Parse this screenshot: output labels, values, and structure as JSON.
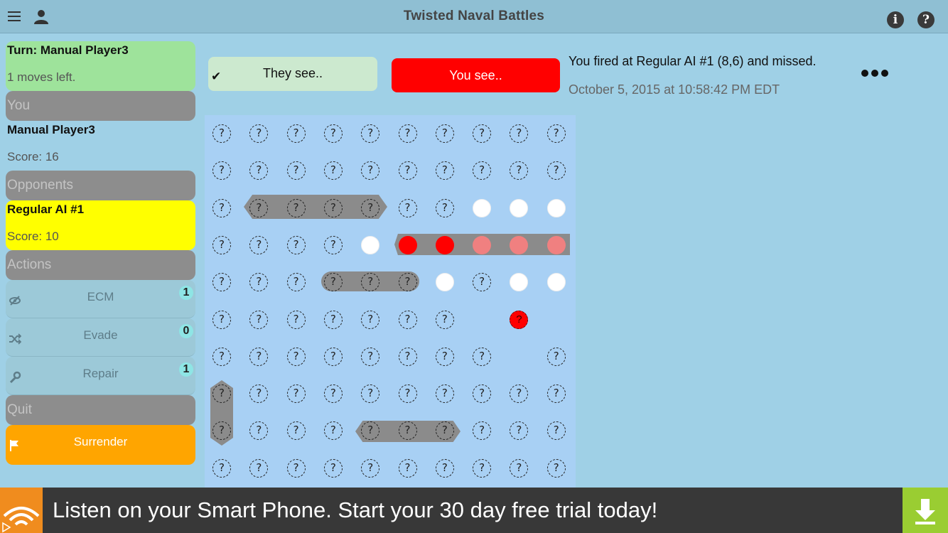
{
  "app": {
    "title": "Twisted Naval Battles"
  },
  "icons": {
    "menu": "menu-icon",
    "profile": "person-icon",
    "info": "info-icon",
    "help": "help-icon",
    "info_glyph": "i",
    "help_glyph": "?"
  },
  "sidebar": {
    "turn_label": "Turn: Manual Player3",
    "moves_left": "1 moves left.",
    "you_header": "You",
    "player_name": "Manual Player3",
    "player_score": "Score: 16",
    "opponents_header": "Opponents",
    "opponent_name": "Regular AI #1",
    "opponent_score": "Score: 10",
    "actions_header": "Actions",
    "actions": [
      {
        "label": "ECM",
        "count": "1",
        "icon": "eye-slash-icon"
      },
      {
        "label": "Evade",
        "count": "0",
        "icon": "shuffle-icon"
      },
      {
        "label": "Repair",
        "count": "1",
        "icon": "wrench-icon"
      }
    ],
    "quit_header": "Quit",
    "surrender_label": "Surrender"
  },
  "view_tabs": {
    "they_see": "They see..",
    "you_see": "You see..",
    "checkmark": "✔"
  },
  "status": {
    "message": "You fired at Regular AI #1 (8,6) and missed.",
    "timestamp": "October 5, 2015 at 10:58:42 PM EDT"
  },
  "board": {
    "unknown_glyph": "?",
    "hit_glyph": "?",
    "rows": [
      "UUUUUUUUUU",
      "UUUUUUUUUU",
      "UUUUUUUMMM",
      "UUUUMHHSSS",
      "UUUUUUMUMM",
      "UUUUUUUEQE",
      "UUUUUUUUEU",
      "UUUUUUUUUU",
      "UUUUUUUUUU",
      "UUUUUUUUUU"
    ],
    "legend": {
      "U": "unknown",
      "M": "miss",
      "H": "hit",
      "S": "sunk-hit",
      "Q": "hit-unconfirmed",
      "E": "empty"
    }
  },
  "ad": {
    "text": "Listen on your Smart Phone. Start your 30 day free trial today!",
    "logo": "audible-icon",
    "download": "download-icon"
  },
  "colors": {
    "background": "#9fd0e6",
    "turn_panel": "#9ee39b",
    "opponent_panel": "#ffff00",
    "you_see_button": "#ff0000",
    "they_see_button": "#cce9cf",
    "surrender": "#ffa500",
    "hit": "#ff0000",
    "sunk": "#f08080",
    "ship": "#8b8b8b"
  }
}
